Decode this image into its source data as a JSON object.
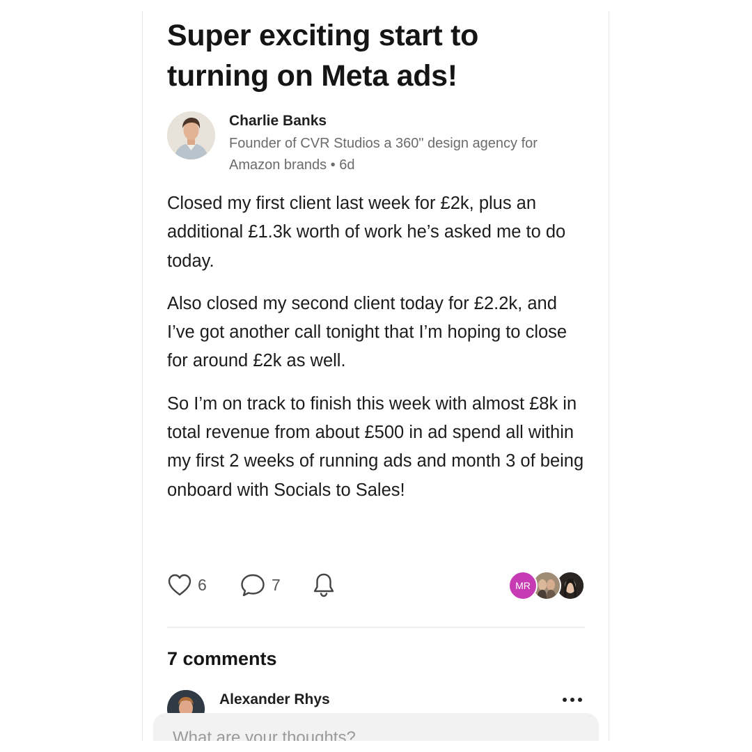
{
  "post": {
    "title": "Super exciting start to turning on Meta ads!",
    "author": {
      "name": "Charlie Banks",
      "bio": "Founder of CVR Studios a 360\" design agency for Amazon brands",
      "age": "6d"
    },
    "paragraphs": [
      "Closed my first client last week for £2k, plus an additional £1.3k worth of work he’s asked me to do today.",
      "Also closed my second client today for £2.2k, and I’ve got another call tonight that I’m hoping to close for around £2k as well.",
      "So I’m on track to finish this week with almost £8k in total revenue from about £500 in ad spend all within my first 2 weeks of running ads and month 3 of being onboard with Socials to Sales!"
    ],
    "actions": {
      "likes": "6",
      "comments": "7",
      "like_icon": "heart-icon",
      "comment_icon": "speech-bubble-icon",
      "notify_icon": "bell-icon"
    },
    "participants": [
      {
        "initials": "MR",
        "color": "#c63bb4"
      },
      {
        "initials": "",
        "color": "#8c7a66"
      },
      {
        "initials": "",
        "color": "#3b3330"
      }
    ]
  },
  "comments": {
    "heading": "7 comments",
    "items": [
      {
        "name": "Alexander Rhys"
      }
    ]
  },
  "composer": {
    "placeholder": "What are your thoughts?"
  }
}
